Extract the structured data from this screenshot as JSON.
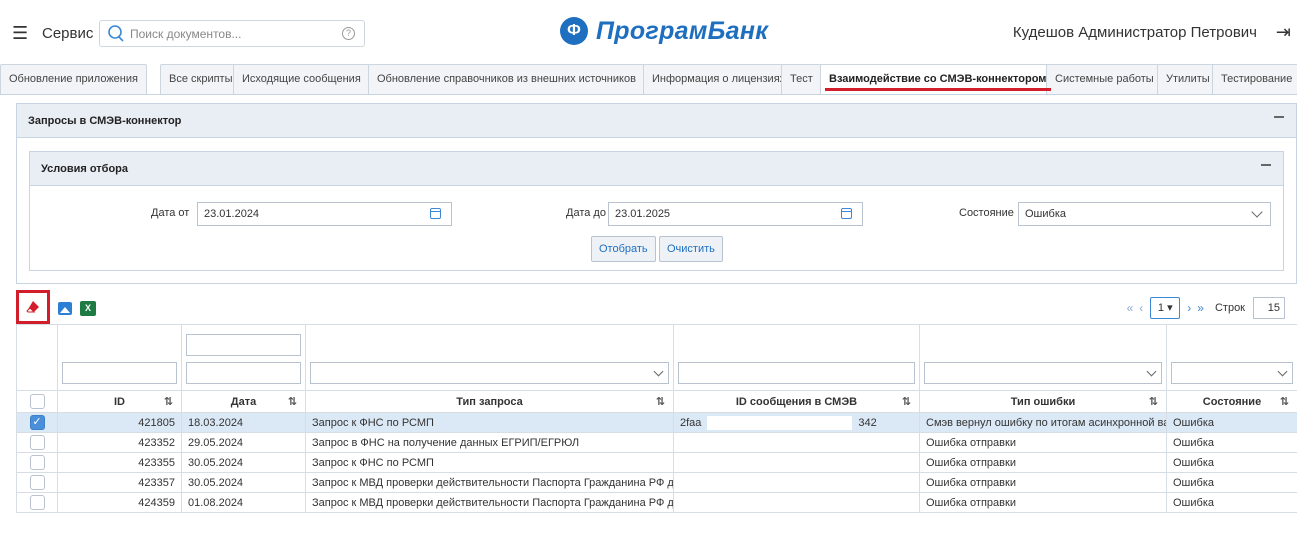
{
  "header": {
    "service_label": "Сервис",
    "search_placeholder": "Поиск документов...",
    "logo_text": "ПрограмБанк",
    "user_name": "Кудешов Администратор Петрович"
  },
  "tabs": [
    {
      "label": "Обновление приложения"
    },
    {
      "label": "Все скрипты"
    },
    {
      "label": "Исходящие сообщения"
    },
    {
      "label": "Обновление справочников из внешних источников"
    },
    {
      "label": "Информация о лицензиях"
    },
    {
      "label": "Тест"
    },
    {
      "label": "Взаимодействие со СМЭВ-коннектором",
      "active": true
    },
    {
      "label": "Системные работы"
    },
    {
      "label": "Утилиты"
    },
    {
      "label": "Тестирование"
    }
  ],
  "panel": {
    "title": "Запросы в СМЭВ-коннектор",
    "filter": {
      "title": "Условия отбора",
      "date_from_label": "Дата от",
      "date_from_value": "23.01.2024",
      "date_to_label": "Дата до",
      "date_to_value": "23.01.2025",
      "state_label": "Состояние",
      "state_value": "Ошибка",
      "apply_button": "Отобрать",
      "clear_button": "Очистить"
    }
  },
  "pager": {
    "page": "1",
    "rows_label": "Строк",
    "rows_value": "15"
  },
  "table": {
    "columns": [
      "ID",
      "Дата",
      "Тип запроса",
      "ID сообщения в СМЭВ",
      "Тип ошибки",
      "Состояние"
    ],
    "rows": [
      {
        "checked": true,
        "id": "421805",
        "date": "18.03.2024",
        "type": "Запрос к ФНС по РСМП",
        "msg_start": "2faa",
        "msg_end": "342",
        "error": "Смэв вернул ошибку по итогам асинхронной вали",
        "state": "Ошибка"
      },
      {
        "checked": false,
        "id": "423352",
        "date": "29.05.2024",
        "type": "Запрос в ФНС на получение данных ЕГРИП/ЕГРЮЛ",
        "msg_start": "",
        "msg_end": "",
        "error": "Ошибка отправки",
        "state": "Ошибка"
      },
      {
        "checked": false,
        "id": "423355",
        "date": "30.05.2024",
        "type": "Запрос к ФНС по РСМП",
        "msg_start": "",
        "msg_end": "",
        "error": "Ошибка отправки",
        "state": "Ошибка"
      },
      {
        "checked": false,
        "id": "423357",
        "date": "30.05.2024",
        "type": "Запрос к МВД проверки действительности Паспорта Гражданина РФ для бан",
        "msg_start": "",
        "msg_end": "",
        "error": "Ошибка отправки",
        "state": "Ошибка"
      },
      {
        "checked": false,
        "id": "424359",
        "date": "01.08.2024",
        "type": "Запрос к МВД проверки действительности Паспорта Гражданина РФ для бан",
        "msg_start": "",
        "msg_end": "",
        "error": "Ошибка отправки",
        "state": "Ошибка"
      }
    ]
  },
  "icons": {
    "clear": "eraser-icon",
    "export_image": "image-icon",
    "export_excel": "excel-icon"
  },
  "colors": {
    "brand": "#1e6fbf",
    "highlight": "#d21d2b",
    "selected_row": "#dbe8f6"
  }
}
